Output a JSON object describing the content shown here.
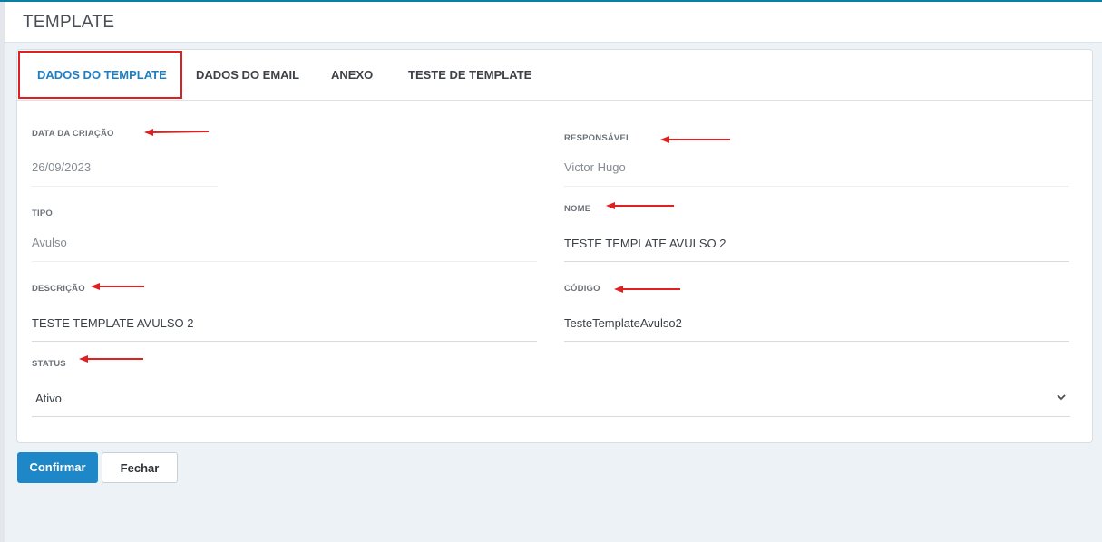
{
  "header": {
    "title": "TEMPLATE"
  },
  "tabs": [
    {
      "label": "DADOS DO TEMPLATE",
      "active": true
    },
    {
      "label": "DADOS DO EMAIL",
      "active": false
    },
    {
      "label": "ANEXO",
      "active": false
    },
    {
      "label": "TESTE DE TEMPLATE",
      "active": false
    }
  ],
  "form": {
    "data_criacao": {
      "label": "DATA DA CRIAÇÃO",
      "value": "26/09/2023"
    },
    "responsavel": {
      "label": "RESPONSÁVEL",
      "value": "Victor Hugo"
    },
    "tipo": {
      "label": "TIPO",
      "value": "Avulso"
    },
    "nome": {
      "label": "NOME",
      "value": "TESTE TEMPLATE AVULSO 2"
    },
    "descricao": {
      "label": "DESCRIÇÃO",
      "value": "TESTE TEMPLATE AVULSO 2"
    },
    "codigo": {
      "label": "CÓDIGO",
      "value": "TesteTemplateAvulso2"
    },
    "status": {
      "label": "STATUS",
      "value": "Ativo"
    }
  },
  "buttons": {
    "confirm": "Confirmar",
    "close": "Fechar"
  },
  "colors": {
    "accent": "#1d87c8",
    "annotation": "#e02020"
  }
}
